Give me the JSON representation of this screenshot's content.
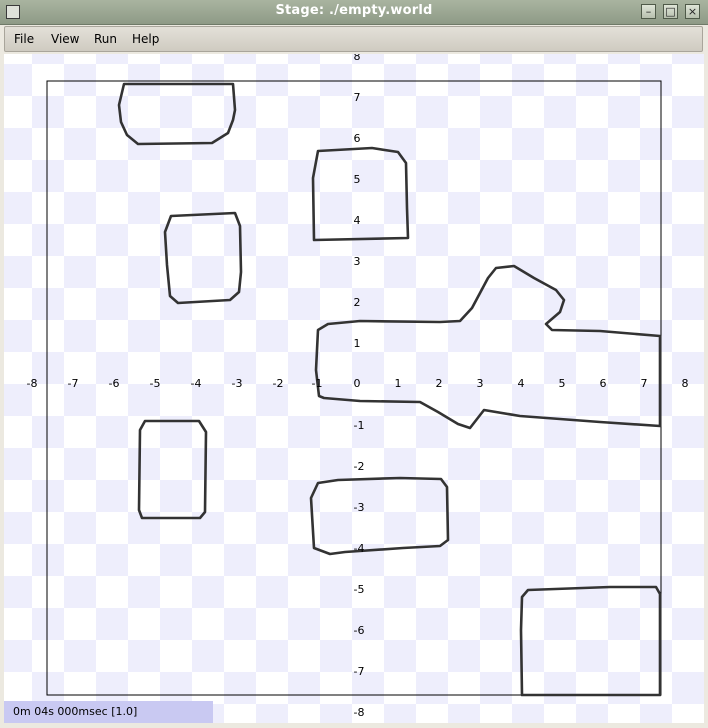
{
  "window": {
    "title": "Stage: ./empty.world"
  },
  "menu": {
    "items": [
      "File",
      "View",
      "Run",
      "Help"
    ]
  },
  "axes": {
    "x_ticks": [
      "-8",
      "-7",
      "-6",
      "-5",
      "-4",
      "-3",
      "-2",
      "-1",
      "0",
      "1",
      "2",
      "3",
      "4",
      "5",
      "6",
      "7",
      "8"
    ],
    "y_ticks": [
      "8",
      "7",
      "6",
      "5",
      "4",
      "3",
      "2",
      "1",
      "-1",
      "-2",
      "-3",
      "-4",
      "-5",
      "-6",
      "-7",
      "-8"
    ]
  },
  "status": {
    "text": "0m 04s 000msec [1.0]"
  },
  "colors": {
    "checker": "#eeeefc",
    "obstacle": "#333333",
    "status_bg": "#c9c9f2"
  }
}
